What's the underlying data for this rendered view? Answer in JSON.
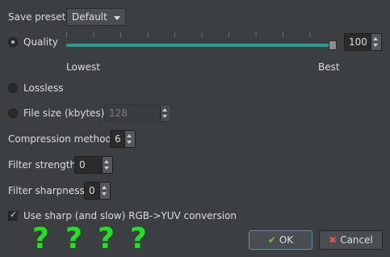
{
  "preset": {
    "label": "Save preset",
    "value": "Default"
  },
  "quality": {
    "label": "Quality",
    "value": "100",
    "min_label": "Lowest",
    "max_label": "Best",
    "slider_fraction": 1.0
  },
  "lossless": {
    "label": "Lossless"
  },
  "filesize": {
    "label": "File size (kbytes)",
    "value": "128"
  },
  "compression": {
    "label": "Compression method",
    "value": "6"
  },
  "filter_strength": {
    "label": "Filter strength",
    "value": "0"
  },
  "filter_sharpness": {
    "label": "Filter sharpness",
    "value": "0"
  },
  "sharp_yuv": {
    "label": "Use sharp (and slow) RGB->YUV conversion",
    "checked": true
  },
  "buttons": {
    "ok": "OK",
    "cancel": "Cancel"
  },
  "overlay_marks": [
    "?",
    "?",
    "?",
    "?"
  ],
  "colors": {
    "accent": "#2a9d8f",
    "overlay": "#22e022",
    "background": "#3c3f41"
  }
}
